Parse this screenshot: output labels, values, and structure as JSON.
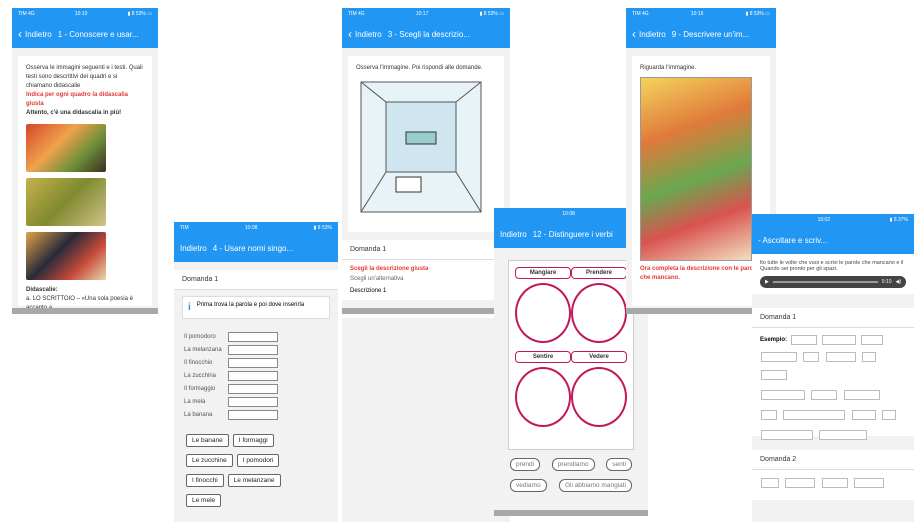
{
  "colors": {
    "accent": "#2196f3",
    "answer": "#e53935",
    "circle": "#c2185b"
  },
  "screen1": {
    "status_left": "TIM  4G",
    "status_time": "10:10",
    "status_right": "▮ 8 53% ▭",
    "back": "Indietro",
    "title": "1 - Conoscere e usar...",
    "intro": "Osserva le immagini seguenti e i testi. Quali testi sono descrittivi dei quadri e si chiamano didascalie",
    "instruction": "Indica per ogni quadro la didascalia giusta",
    "question": "Attento, c'è una didascalia in più!",
    "caption_title": "Didascalie:",
    "caption_item": "a. LO SCRITTOIO – «Una sola poesia è accanto a"
  },
  "screen2": {
    "back": "Indietro",
    "title": "4 - Usare nomi singo...",
    "section": "Domanda 1",
    "info": "Prima trova la parola e poi dove inserirla",
    "labels": [
      "Il pomodoro",
      "La melanzana",
      "Il finocchio",
      "La zucchina",
      "Il formaggio",
      "La mela",
      "La banana"
    ],
    "chips": [
      [
        "Le banane",
        "I formaggi"
      ],
      [
        "Le zucchine",
        "I pomodori"
      ],
      [
        "I finocchi",
        "Le melanzane"
      ],
      [
        "Le mele"
      ]
    ]
  },
  "screen3": {
    "status_left": "TIM  4G",
    "status_time": "10:17",
    "status_right": "▮ 8 53% ▭",
    "back": "Indietro",
    "title": "3 - Scegli la descrizio...",
    "intro": "Osserva l'immagine. Poi rispondi alle domande.",
    "section": "Domanda 1",
    "instruction": "Scegli la descrizione giusta",
    "subtext": "Scegli un'alternativa",
    "option": "Descrizione 1"
  },
  "screen4": {
    "status_time": "10:08",
    "back": "Indietro",
    "title": "12 - Distinguere i verbi",
    "pills": [
      "Mangiare",
      "Prendere",
      "Sentire",
      "Vedere"
    ],
    "words_row1": [
      "prendi",
      "prendiamo",
      "senti"
    ],
    "words_row2": [
      "vediamo",
      "Gli abbiamo mangiati"
    ]
  },
  "screen5": {
    "status_left": "TIM  4G",
    "status_time": "10:16",
    "status_right": "▮ 8 53% ▭",
    "back": "Indietro",
    "title": "9 - Descrivere un'im...",
    "intro": "Riguarda l'immagine.",
    "answer": "Ora completa la descrizione con le parole che mancano."
  },
  "screen6": {
    "status_time": "10:02",
    "title": "- Ascoltare e scriv...",
    "intro": "lto tutte le volte che vuoi e scrivi le parole che mancano e il Quando sei pronto per gli spazi.",
    "time": "0:10",
    "section1": "Domanda 1",
    "label": "Esempio:",
    "section2": "Domanda 2"
  }
}
